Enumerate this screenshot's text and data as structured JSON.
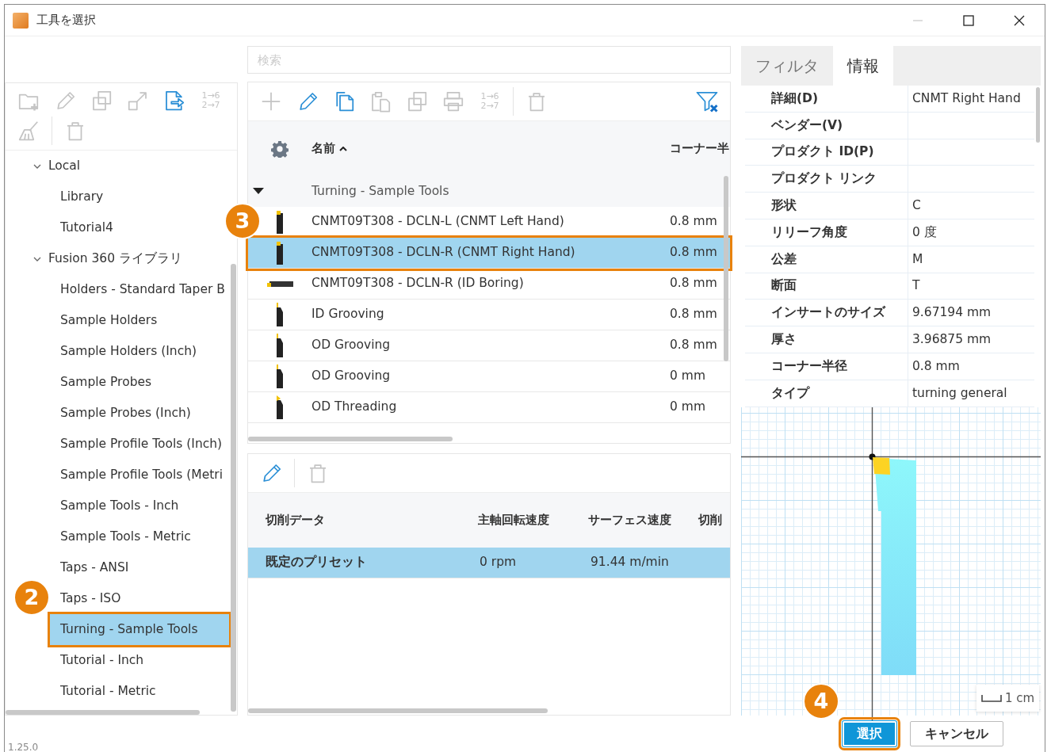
{
  "window": {
    "title": "工具を選択"
  },
  "library_toolbar": [
    {
      "kind": "folder-plus",
      "enabled": false
    },
    {
      "kind": "pencil",
      "enabled": false
    },
    {
      "kind": "duplicate",
      "enabled": false
    },
    {
      "kind": "import",
      "enabled": false
    },
    {
      "kind": "export",
      "enabled": true
    },
    {
      "kind": "renumber",
      "enabled": false,
      "lines": [
        "1→6",
        "2→7"
      ]
    },
    {
      "kind": "broom",
      "enabled": false
    },
    {
      "kind": "separator"
    },
    {
      "kind": "trash",
      "enabled": false
    }
  ],
  "library_tree": [
    {
      "label": "Local",
      "expanded": true,
      "selected": false,
      "children": [
        {
          "label": "Library",
          "selected": false
        },
        {
          "label": "Tutorial4",
          "selected": false
        }
      ]
    },
    {
      "label": "Fusion 360 ライブラリ",
      "expanded": true,
      "selected": false,
      "children": [
        {
          "label": "Holders - Standard Taper B",
          "selected": false
        },
        {
          "label": "Sample Holders",
          "selected": false
        },
        {
          "label": "Sample Holders (Inch)",
          "selected": false
        },
        {
          "label": "Sample Probes",
          "selected": false
        },
        {
          "label": "Sample Probes (Inch)",
          "selected": false
        },
        {
          "label": "Sample Profile Tools (Inch)",
          "selected": false
        },
        {
          "label": "Sample Profile Tools (Metri",
          "selected": false
        },
        {
          "label": "Sample Tools - Inch",
          "selected": false
        },
        {
          "label": "Sample Tools - Metric",
          "selected": false
        },
        {
          "label": "Taps - ANSI",
          "selected": false
        },
        {
          "label": "Taps - ISO",
          "selected": false
        },
        {
          "label": "Turning - Sample Tools",
          "selected": true,
          "callout": "2"
        },
        {
          "label": "Tutorial - Inch",
          "selected": false
        },
        {
          "label": "Tutorial - Metric",
          "selected": false
        }
      ]
    }
  ],
  "search": {
    "placeholder": "検索"
  },
  "tool_toolbar": [
    {
      "kind": "plus",
      "enabled": false
    },
    {
      "kind": "pencil",
      "enabled": true
    },
    {
      "kind": "copy",
      "enabled": true
    },
    {
      "kind": "paste",
      "enabled": false
    },
    {
      "kind": "duplicate",
      "enabled": false
    },
    {
      "kind": "print",
      "enabled": false
    },
    {
      "kind": "renumber",
      "enabled": false,
      "lines": [
        "1→6",
        "2→7"
      ]
    },
    {
      "kind": "separator"
    },
    {
      "kind": "trash",
      "enabled": false
    },
    {
      "kind": "filter-clear",
      "enabled": true
    }
  ],
  "tool_table": {
    "columns": [
      {
        "label": "名前",
        "sort_ascending": true
      },
      {
        "label": "コーナー半"
      }
    ],
    "groups": [
      {
        "label": "Turning - Sample Tools",
        "expanded": true,
        "rows": [
          {
            "name": "CNMT09T308 - DCLN-L (CNMT Left Hand)",
            "corner_radius": "0.8 mm",
            "kind": "turning",
            "selected": false
          },
          {
            "name": "CNMT09T308 - DCLN-R (CNMT Right Hand)",
            "corner_radius": "0.8 mm",
            "kind": "turning",
            "selected": true,
            "callout": "3"
          },
          {
            "name": "CNMT09T308 - DCLN-R (ID Boring)",
            "corner_radius": "0.8 mm",
            "kind": "boring",
            "selected": false
          },
          {
            "name": "ID Grooving",
            "corner_radius": "0.8 mm",
            "kind": "grooving",
            "selected": false
          },
          {
            "name": "OD Grooving",
            "corner_radius": "0.8 mm",
            "kind": "grooving",
            "selected": false
          },
          {
            "name": "OD Grooving",
            "corner_radius": "0 mm",
            "kind": "grooving",
            "selected": false
          },
          {
            "name": "OD Threading",
            "corner_radius": "0 mm",
            "kind": "threading",
            "selected": false
          }
        ]
      }
    ]
  },
  "preset_toolbar": [
    {
      "kind": "pencil",
      "enabled": true
    },
    {
      "kind": "separator"
    },
    {
      "kind": "trash",
      "enabled": false
    }
  ],
  "preset_table": {
    "columns": [
      "切削データ",
      "主軸回転速度",
      "サーフェス速度",
      "切削"
    ],
    "rows": [
      {
        "cells": [
          "既定のプリセット",
          "0 rpm",
          "91.44 m/min"
        ],
        "selected": true
      }
    ]
  },
  "panel_tabs": [
    {
      "label": "フィルタ",
      "selected": false
    },
    {
      "label": "情報",
      "selected": true
    }
  ],
  "properties": [
    {
      "label": "詳細(D)",
      "value": "CNMT Right Hand"
    },
    {
      "label": "ベンダー(V)"
    },
    {
      "label": "プロダクト ID(P)"
    },
    {
      "label": "プロダクト リンク"
    },
    {
      "label": "形状",
      "value": "C"
    },
    {
      "label": "リリーフ角度",
      "value": "0 度"
    },
    {
      "label": "公差",
      "value": "M"
    },
    {
      "label": "断面",
      "value": "T"
    },
    {
      "label": "インサートのサイズ",
      "value": "9.67194 mm"
    },
    {
      "label": "厚さ",
      "value": "3.96875 mm"
    },
    {
      "label": "コーナー半径",
      "value": "0.8 mm"
    },
    {
      "label": "タイプ",
      "value": "turning general"
    }
  ],
  "preview": {
    "scale": "1 cm"
  },
  "buttons": [
    {
      "label": "選択",
      "kind": "primary",
      "callout": "4"
    },
    {
      "label": "キャンセル",
      "kind": "secondary"
    }
  ],
  "version": "1.25.0"
}
